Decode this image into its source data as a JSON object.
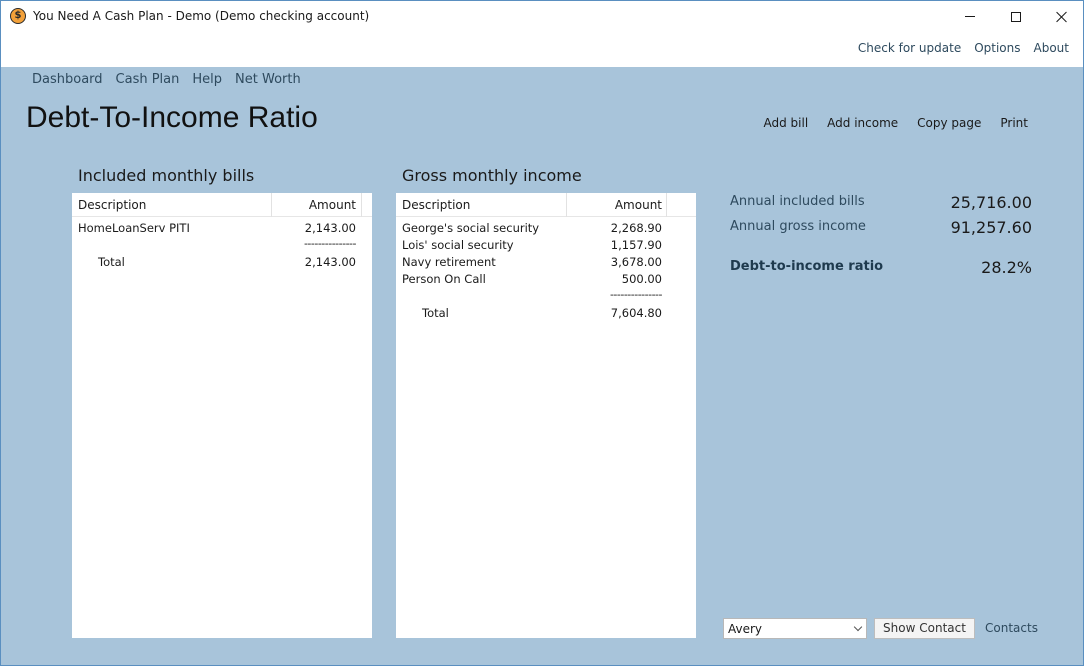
{
  "window": {
    "title": "You Need A Cash Plan - Demo (Demo checking account)",
    "icon_glyph": "$"
  },
  "top_links": [
    "Check for update",
    "Options",
    "About"
  ],
  "nav": [
    "Dashboard",
    "Cash Plan",
    "Help",
    "Net Worth"
  ],
  "page_title": "Debt-To-Income Ratio",
  "actions": [
    "Add bill",
    "Add income",
    "Copy page",
    "Print"
  ],
  "bills": {
    "title": "Included monthly bills",
    "columns": {
      "description": "Description",
      "amount": "Amount"
    },
    "rows": [
      {
        "description": "HomeLoanServ PITI",
        "amount": "2,143.00"
      }
    ],
    "separator": "---------------",
    "total_label": "Total",
    "total": "2,143.00"
  },
  "income": {
    "title": "Gross monthly income",
    "columns": {
      "description": "Description",
      "amount": "Amount"
    },
    "rows": [
      {
        "description": "George's social security",
        "amount": "2,268.90"
      },
      {
        "description": "Lois' social security",
        "amount": "1,157.90"
      },
      {
        "description": "Navy retirement",
        "amount": "3,678.00"
      },
      {
        "description": "Person On Call",
        "amount": "500.00"
      }
    ],
    "separator": "---------------",
    "total_label": "Total",
    "total": "7,604.80"
  },
  "summary": {
    "annual_bills_label": "Annual included bills",
    "annual_bills": "25,716.00",
    "annual_income_label": "Annual gross income",
    "annual_income": "91,257.60",
    "ratio_label": "Debt-to-income ratio",
    "ratio": "28.2%"
  },
  "contact": {
    "selected": "Avery",
    "show_button": "Show Contact",
    "contacts_link": "Contacts"
  }
}
